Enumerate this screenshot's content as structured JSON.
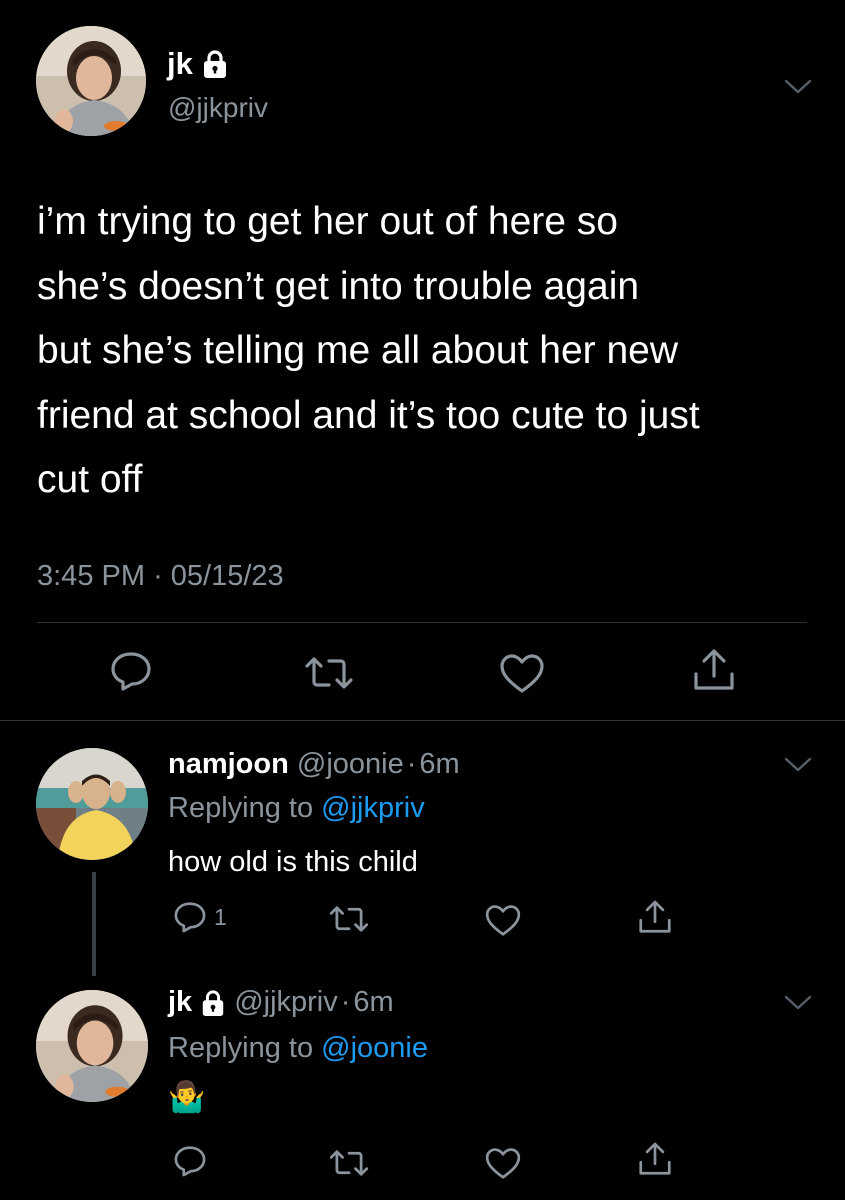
{
  "main_tweet": {
    "display_name": "jk",
    "handle": "@jjkpriv",
    "text_lines": [
      "i’m trying to get her out of here so",
      "she’s doesn’t get into trouble again",
      "but she’s telling me all about her new",
      "friend at school and it’s too cute to just",
      "cut off"
    ],
    "time": "3:45 PM",
    "separator": "·",
    "date": "05/15/23"
  },
  "replies": [
    {
      "display_name": "namjoon",
      "handle": "@joonie",
      "separator": "·",
      "age": "6m",
      "replying_prefix": "Replying to",
      "replying_to": "@jjkpriv",
      "text": "how old is this child",
      "reply_count": "1"
    },
    {
      "display_name": "jk",
      "handle": "@jjkpriv",
      "separator": "·",
      "age": "6m",
      "replying_prefix": "Replying to",
      "replying_to": "@joonie",
      "text": "🤷‍♂️"
    }
  ],
  "colors": {
    "background": "#000000",
    "text": "#ffffff",
    "muted": "#8b949c",
    "link": "#1d9bf0",
    "divider": "#2f3336"
  },
  "icons": [
    "lock-icon",
    "chevron-down-icon",
    "reply-icon",
    "retweet-icon",
    "like-icon",
    "share-icon"
  ]
}
